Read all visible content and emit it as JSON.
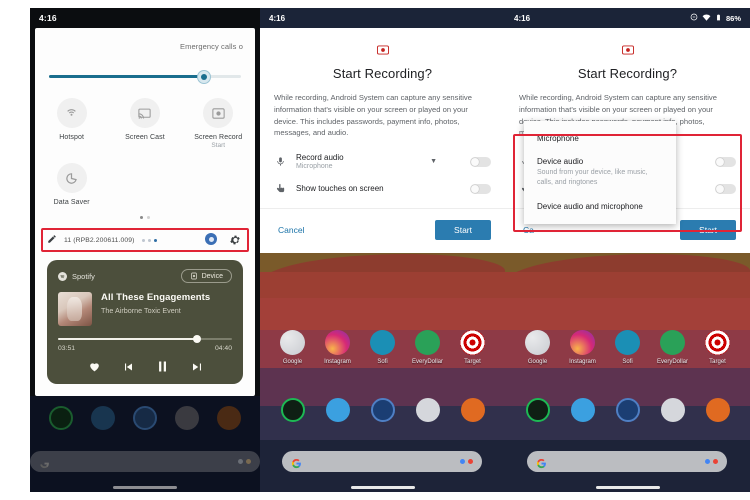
{
  "panel_left": {
    "status": {
      "time": "4:16"
    },
    "quick_settings": {
      "emergency_label": "Emergency calls o",
      "brightness": {
        "name": "brightness-slider",
        "value_pct": 78
      },
      "tiles": [
        {
          "label": "Hotspot",
          "sublabel": "",
          "icon": "hotspot-icon"
        },
        {
          "label": "Screen Cast",
          "sublabel": "",
          "icon": "cast-icon"
        },
        {
          "label": "Screen Record",
          "sublabel": "Start",
          "icon": "screen-record-icon"
        },
        {
          "label": "Data Saver",
          "sublabel": "",
          "icon": "data-saver-icon"
        }
      ],
      "footer": {
        "build_text": "11 (RPB2.200611.009)",
        "edit_icon": "pencil-icon",
        "user_icon": "user-icon",
        "settings_icon": "gear-icon"
      }
    },
    "media_player": {
      "app_name": "Spotify",
      "device_button": "Device",
      "track_title": "All These Engagements",
      "track_artist": "The Airborne Toxic Event",
      "elapsed": "03:51",
      "duration": "04:40",
      "progress_pct": 78,
      "controls": [
        "favorite-button",
        "previous-button",
        "pause-button",
        "next-button"
      ]
    }
  },
  "phone_middle": {
    "status": {
      "time": "4:16"
    },
    "dialog": {
      "icon": "screen-record-icon",
      "title": "Start Recording?",
      "body": "While recording, Android System can capture any sensitive information that's visible on your screen or played on your device. This includes passwords, payment info, photos, messages, and audio.",
      "options": [
        {
          "icon": "microphone-icon",
          "label": "Record audio",
          "sublabel": "Microphone",
          "has_caret": true,
          "toggle": "off"
        },
        {
          "icon": "touch-icon",
          "label": "Show touches on screen",
          "sublabel": "",
          "has_caret": false,
          "toggle": "off"
        }
      ],
      "cancel_label": "Cancel",
      "start_label": "Start"
    },
    "home": {
      "apps": [
        {
          "label": "Google",
          "icon": "google-app-icon"
        },
        {
          "label": "Instagram",
          "icon": "instagram-icon"
        },
        {
          "label": "Sofi",
          "icon": "sofi-icon"
        },
        {
          "label": "EveryDollar",
          "icon": "everydollar-icon"
        },
        {
          "label": "Target",
          "icon": "target-icon"
        }
      ],
      "dock": [
        {
          "icon": "spotify-icon"
        },
        {
          "icon": "twitter-icon"
        },
        {
          "icon": "blue-app-icon"
        },
        {
          "icon": "adidas-icon"
        },
        {
          "icon": "orange-app-icon"
        }
      ],
      "search": {
        "placeholder": "",
        "left_icon": "google-g-icon",
        "right_icon": "google-lens-icon"
      }
    }
  },
  "phone_right": {
    "status": {
      "time": "4:16",
      "battery": "86%",
      "icons": [
        "dnd-icon",
        "wifi-icon",
        "battery-icon"
      ]
    },
    "dialog": {
      "icon": "screen-record-icon",
      "title": "Start Recording?",
      "body": "While recording, Android System can capture any sensitive information that's visible on your screen or played on your device. This includes passwords, payment info, photos, messages, and audio.",
      "options": [
        {
          "icon": "microphone-icon",
          "toggle": "off"
        },
        {
          "icon": "touch-icon",
          "toggle": "off"
        }
      ],
      "cancel_label": "Ca",
      "start_label": "Start"
    },
    "audio_menu": {
      "items": [
        {
          "label": "Microphone",
          "sublabel": ""
        },
        {
          "label": "Device audio",
          "sublabel": "Sound from your device, like music, calls, and ringtones"
        },
        {
          "label": "Device audio and microphone",
          "sublabel": ""
        }
      ]
    },
    "home": {
      "apps": [
        {
          "label": "Google",
          "icon": "google-app-icon"
        },
        {
          "label": "Instagram",
          "icon": "instagram-icon"
        },
        {
          "label": "Sofi",
          "icon": "sofi-icon"
        },
        {
          "label": "EveryDollar",
          "icon": "everydollar-icon"
        },
        {
          "label": "Target",
          "icon": "target-icon"
        }
      ],
      "dock": [
        {
          "icon": "spotify-icon"
        },
        {
          "icon": "twitter-icon"
        },
        {
          "icon": "blue-app-icon"
        },
        {
          "icon": "adidas-icon"
        },
        {
          "icon": "orange-app-icon"
        }
      ],
      "search": {
        "placeholder": "",
        "left_icon": "google-g-icon",
        "right_icon": "google-lens-icon"
      }
    }
  },
  "annotations": {
    "highlight_color": "#e02436",
    "boxes": [
      "build-number-row-highlight",
      "audio-options-highlight"
    ]
  }
}
